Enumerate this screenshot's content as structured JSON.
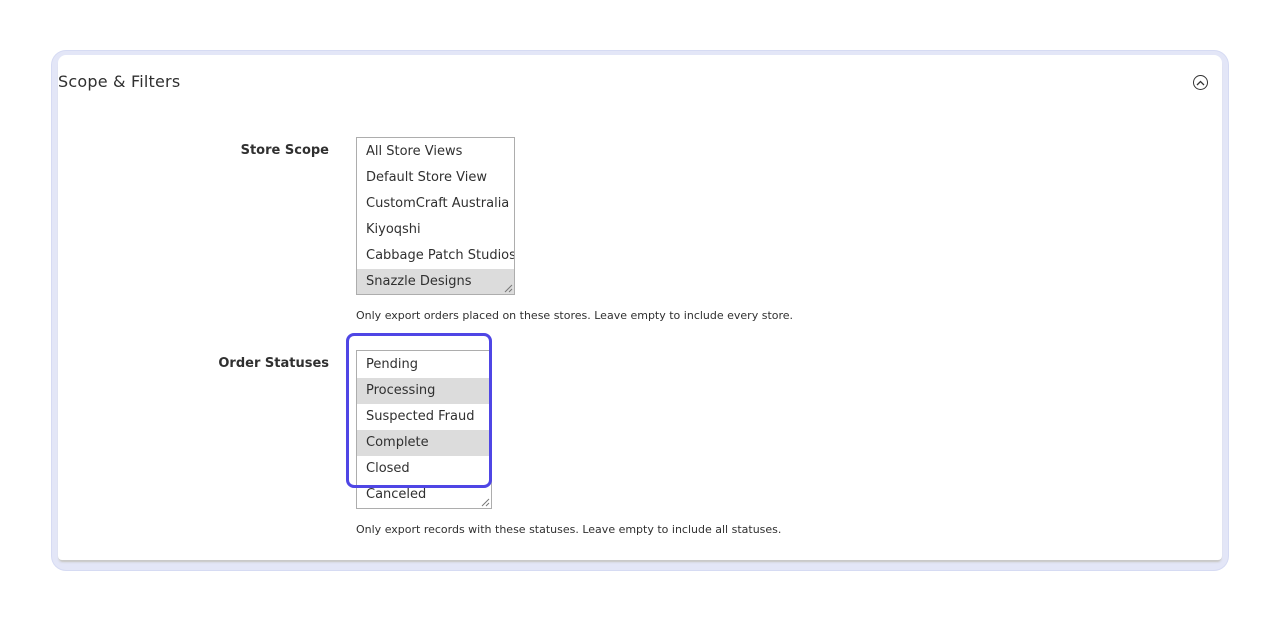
{
  "section": {
    "title": "Scope & Filters",
    "collapse_icon": "chevron-up-circle-icon"
  },
  "store_scope": {
    "label": "Store Scope",
    "options": [
      {
        "label": "All Store Views",
        "selected": false
      },
      {
        "label": "Default Store View",
        "selected": false
      },
      {
        "label": "CustomCraft Australia",
        "selected": false
      },
      {
        "label": "Kiyoqshi",
        "selected": false
      },
      {
        "label": "Cabbage Patch Studios",
        "selected": false
      },
      {
        "label": "Snazzle Designs",
        "selected": true
      }
    ],
    "note": "Only export orders placed on these stores. Leave empty to include every store."
  },
  "order_statuses": {
    "label": "Order Statuses",
    "options": [
      {
        "label": "Pending",
        "selected": false
      },
      {
        "label": "Processing",
        "selected": true
      },
      {
        "label": "Suspected Fraud",
        "selected": false
      },
      {
        "label": "Complete",
        "selected": true
      },
      {
        "label": "Closed",
        "selected": false
      },
      {
        "label": "Canceled",
        "selected": false
      }
    ],
    "note": "Only export records with these statuses. Leave empty to include all statuses."
  },
  "colors": {
    "highlight": "#4f46e5",
    "selected_option": "#dcdcdc"
  }
}
